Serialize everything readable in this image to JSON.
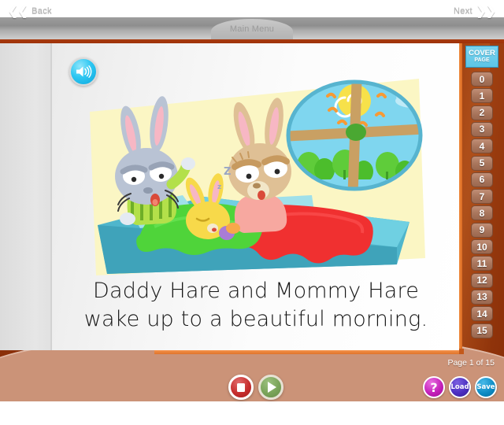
{
  "topbar": {
    "back_label": "Back",
    "back_icon": "double-chevron-left-icon",
    "next_label": "Next",
    "next_icon": "double-chevron-right-icon",
    "main_menu_label": "Main Menu"
  },
  "book": {
    "speaker_icon": "speaker-sound-icon",
    "story_line_1": "Daddy Hare and Mommy Hare",
    "story_line_2": "wake up to a beautiful morning.",
    "page_indicator": "Page 1 of 15"
  },
  "illustration": {
    "alt": "Daddy Hare in green striped pajamas and Mommy Hare waking up in bed with a sleeping baby bunny, beside a round window showing the sun",
    "background_color": "#fbf6c4",
    "bed_color": "#5cc3d6",
    "green_blanket_color": "#4fd43a",
    "red_blanket_color": "#f03030",
    "sky_color": "#7fd6ef",
    "sun_color": "#f7e14a"
  },
  "sidebar": {
    "cover_line_1": "COVER",
    "cover_line_2": "PAGE",
    "pages": [
      "0",
      "1",
      "2",
      "3",
      "4",
      "5",
      "6",
      "7",
      "8",
      "9",
      "10",
      "11",
      "12",
      "13",
      "14",
      "15"
    ]
  },
  "controls": {
    "stop_icon": "stop-icon",
    "play_icon": "play-icon",
    "help_label": "?",
    "load_label": "Load",
    "save_label": "Save"
  },
  "colors": {
    "background_brown": "#8a2f08",
    "footer_tan": "#cb9378",
    "accent_orange": "#f08a3c",
    "cover_blue": "#5cc5e6"
  }
}
